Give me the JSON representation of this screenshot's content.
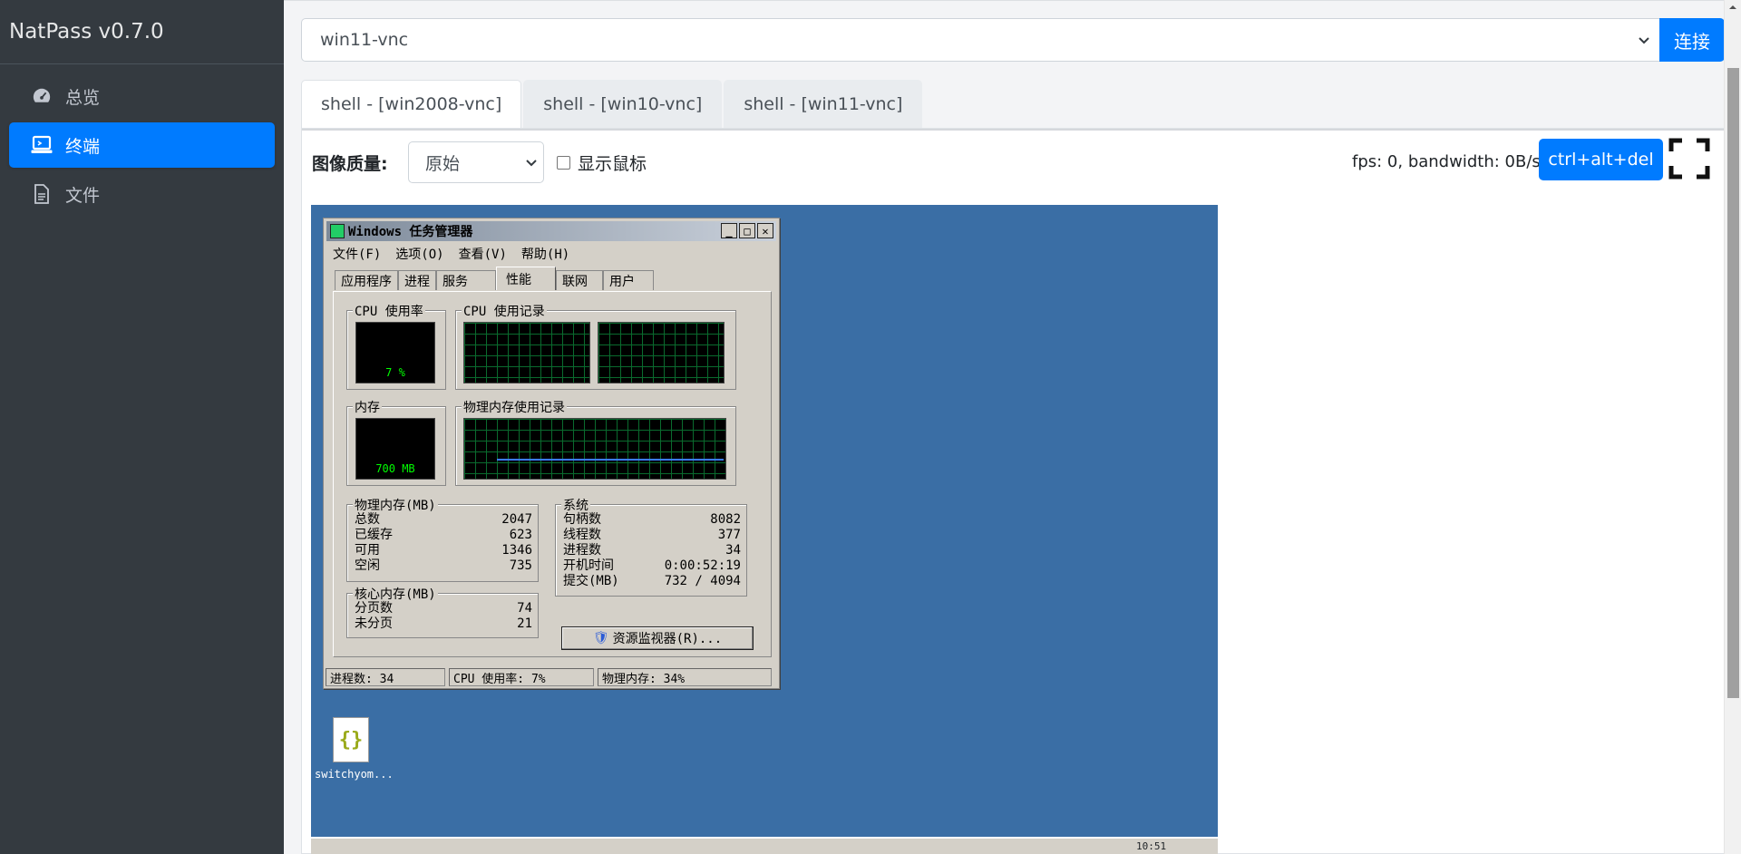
{
  "app": {
    "brand": "NatPass v0.7.0"
  },
  "sidebar": {
    "items": [
      {
        "label": "总览",
        "icon": "gauge-icon"
      },
      {
        "label": "终端",
        "icon": "laptop-icon",
        "active": true
      },
      {
        "label": "文件",
        "icon": "file-icon"
      }
    ]
  },
  "connect": {
    "selected_host": "win11-vnc",
    "button_label": "连接"
  },
  "tabs": [
    {
      "label": "shell - [win2008-vnc]",
      "active": true
    },
    {
      "label": "shell - [win10-vnc]"
    },
    {
      "label": "shell - [win11-vnc]"
    }
  ],
  "toolbar": {
    "quality_label": "图像质量:",
    "quality_value": "原始",
    "show_cursor_label": "显示鼠标",
    "fps_text": "fps: 0, bandwidth: 0B/s",
    "cad_button": "ctrl+alt+del"
  },
  "remote": {
    "taskmgr": {
      "title": "Windows 任务管理器",
      "menu": [
        "文件(F)",
        "选项(O)",
        "查看(V)",
        "帮助(H)"
      ],
      "tabs": [
        "应用程序",
        "进程",
        "服务",
        "性能",
        "联网",
        "用户"
      ],
      "active_tab": "性能",
      "cpu_usage_title": "CPU 使用率",
      "cpu_usage_value": "7 %",
      "cpu_history_title": "CPU 使用记录",
      "mem_title": "内存",
      "mem_value": "700 MB",
      "mem_history_title": "物理内存使用记录",
      "phys_mem_title": "物理内存(MB)",
      "phys_mem": [
        {
          "k": "总数",
          "v": "2047"
        },
        {
          "k": "已缓存",
          "v": "623"
        },
        {
          "k": "可用",
          "v": "1346"
        },
        {
          "k": "空闲",
          "v": "735"
        }
      ],
      "system_title": "系统",
      "system": [
        {
          "k": "句柄数",
          "v": "8082"
        },
        {
          "k": "线程数",
          "v": "377"
        },
        {
          "k": "进程数",
          "v": "34"
        },
        {
          "k": "开机时间",
          "v": "0:00:52:19"
        },
        {
          "k": "提交(MB)",
          "v": "732 / 4094"
        }
      ],
      "kernel_mem_title": "核心内存(MB)",
      "kernel_mem": [
        {
          "k": "分页数",
          "v": "74"
        },
        {
          "k": "未分页",
          "v": "21"
        }
      ],
      "resmon_button": "资源监视器(R)...",
      "status": [
        "进程数: 34",
        "CPU 使用率: 7%",
        "物理内存: 34%"
      ]
    },
    "desktop_icon_label": "switchyom...",
    "taskbar_clock": "10:51"
  },
  "colors": {
    "accent": "#007bff",
    "sidebar_bg": "#343a40",
    "desktop_bg": "#3a6ea5"
  }
}
